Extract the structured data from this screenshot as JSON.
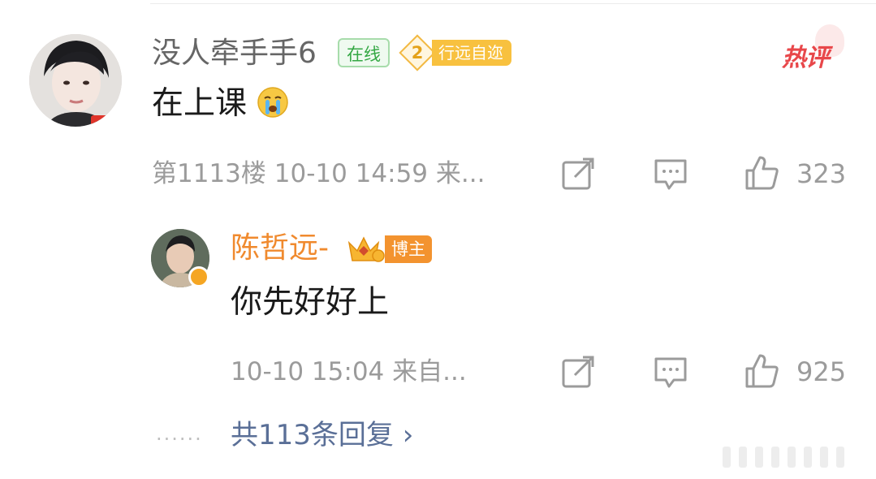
{
  "comment": {
    "username": "没人牵手手6",
    "online_badge": "在线",
    "level_number": "2",
    "level_label": "行远自迩",
    "hot_tag": "热评",
    "text": "在上课",
    "emoji": "crying-face",
    "meta": "第1113楼 10-10 14:59 来...",
    "like_count": "323"
  },
  "reply": {
    "username": "陈哲远-",
    "role_badge": "博主",
    "text": "你先好好上",
    "meta": "10-10 15:04 来自...",
    "like_count": "925"
  },
  "footer": {
    "dots": "......",
    "more_replies": "共113条回复 ›"
  },
  "colors": {
    "username_gray": "#666666",
    "meta_gray": "#9b9b9b",
    "online_green": "#35a845",
    "level_gold": "#f8c13f",
    "hot_red": "#e8474a",
    "blogger_orange": "#f08a2e",
    "link_blue": "#5a6f97"
  }
}
